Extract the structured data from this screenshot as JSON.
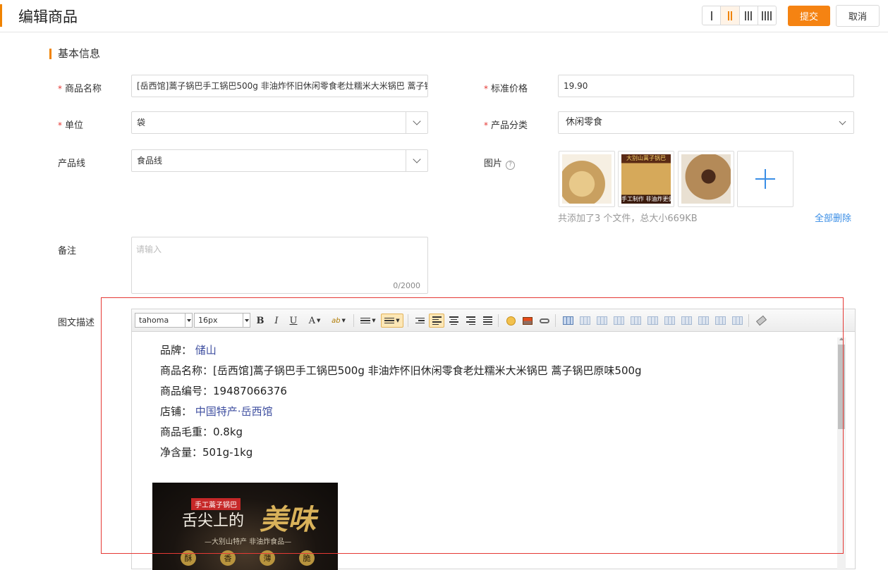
{
  "header": {
    "title": "编辑商品",
    "submit_label": "提交",
    "cancel_label": "取消"
  },
  "section_title": "基本信息",
  "form": {
    "name": {
      "label": "商品名称",
      "value": "[岳西馆]蒿子锅巴手工锅巴500g 非油炸怀旧休闲零食老灶糯米大米锅巴 蒿子锅"
    },
    "price": {
      "label": "标准价格",
      "value": "19.90"
    },
    "unit": {
      "label": "单位",
      "value": "袋"
    },
    "category": {
      "label": "产品分类",
      "value": "休闲零食"
    },
    "line": {
      "label": "产品线",
      "value": "食品线"
    },
    "images": {
      "label": "图片",
      "help": "?",
      "captions": [
        "",
        "手工制作 非油炸更健康",
        ""
      ],
      "thumb2_top": "大别山蒿子锅巴",
      "file_info": "共添加了3 个文件，总大小669KB",
      "delete_all": "全部删除"
    },
    "remark": {
      "label": "备注",
      "placeholder": "请输入",
      "count": "0/2000"
    },
    "description": {
      "label": "图文描述"
    }
  },
  "editor": {
    "font_family": "tahoma",
    "font_size": "16px",
    "toolbar": {
      "bold": "B",
      "italic": "I",
      "underline": "U",
      "font_color": "A",
      "highlight": "ab"
    },
    "content": {
      "brand_label": "品牌：",
      "brand_value": "储山",
      "name_line": "商品名称：[岳西馆]蒿子锅巴手工锅巴500g 非油炸怀旧休闲零食老灶糯米大米锅巴 蒿子锅巴原味500g",
      "sku_line": "商品编号：19487066376",
      "shop_label": "店铺：",
      "shop_value": "中国特产·岳西馆",
      "weight_line": "商品毛重：0.8kg",
      "net_line": "净含量：501g-1kg"
    },
    "banner": {
      "tag": "手工蒿子锅巴",
      "headline": "舌尖上的",
      "gold": "美味",
      "sub": "—大别山特产 非油炸食品—",
      "chars": [
        "酥",
        "香",
        "薄",
        "脆"
      ]
    }
  },
  "colors": {
    "accent": "#f08300",
    "submit_bg": "#f58312",
    "link": "#3a8ee6",
    "required": "#e53935",
    "highlight_box": "#e53935"
  }
}
